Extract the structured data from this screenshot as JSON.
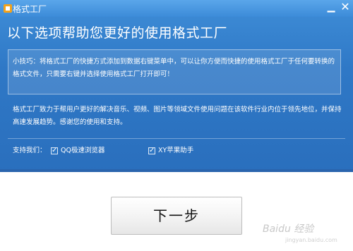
{
  "window": {
    "title": "格式工厂",
    "minimize_label": "▁",
    "close_label": "✕"
  },
  "heading": "以下选项帮助您更好的使用格式工厂",
  "tip": "小技巧：将格式工厂的快捷方式添加到数据右键菜单中，可以让你方便而快捷的使用格式工厂于任何要转换的格式文件，只需要右键并选择使用格式工厂打开即可！",
  "description": "格式工厂致力于帮用户更好的解决音乐、视频、图片等领域文件使用问题在该软件行业内位于领先地位，并保持高速发展趋势。感谢您的使用和支持。",
  "support": {
    "label": "支持我们：",
    "options": [
      {
        "label": "QQ极速浏览器",
        "checked": true
      },
      {
        "label": "XY苹果助手",
        "checked": true
      }
    ]
  },
  "next_button": "下一步",
  "watermark": {
    "text": "Baidu 经验",
    "sub": "jingyan.baidu.com"
  },
  "colors": {
    "dialog_blue": "#2f78c6",
    "title_blue": "#5aa6ea"
  }
}
